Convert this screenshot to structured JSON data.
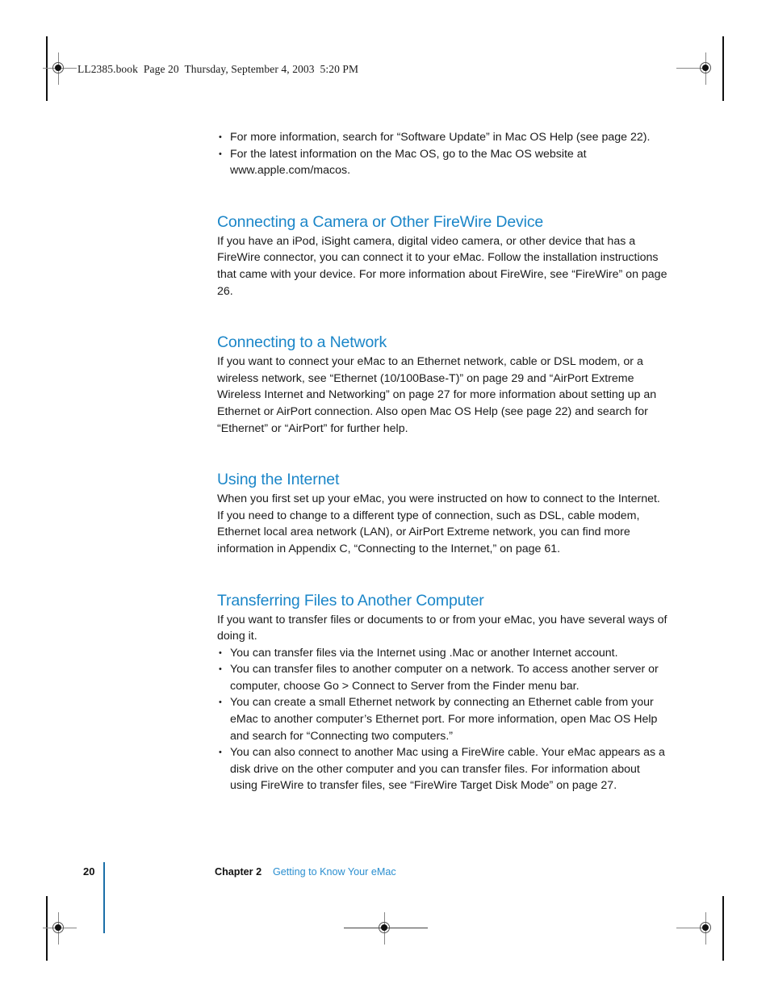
{
  "page": {
    "slug": "LL2385.book  Page 20  Thursday, September 4, 2003  5:20 PM",
    "heading_color": "#1b86c8",
    "body_color": "#1a1a1a",
    "footer_rule_color": "#1b6fa8"
  },
  "intro_bullets": [
    "For more information, search for “Software Update” in Mac OS Help (see page 22).",
    "For the latest information on the Mac OS, go to the Mac OS website at www.apple.com/macos."
  ],
  "sections": [
    {
      "heading": "Connecting a Camera or Other FireWire Device",
      "paragraph": "If you have an iPod, iSight camera, digital video camera, or other device that has a FireWire connector, you can connect it to your eMac. Follow the installation instructions that came with your device. For more information about FireWire, see “FireWire” on page 26.",
      "bullets": []
    },
    {
      "heading": "Connecting to a Network",
      "paragraph": "If you want to connect your eMac to an Ethernet network, cable or DSL modem, or a wireless network, see “Ethernet (10/100Base-T)” on page 29 and “AirPort Extreme Wireless Internet and Networking” on page 27 for more information about setting up an Ethernet or AirPort connection. Also open Mac OS Help (see page 22) and search for “Ethernet” or “AirPort” for further help.",
      "bullets": []
    },
    {
      "heading": "Using the Internet",
      "paragraph": "When you first set up your eMac, you were instructed on how to connect to the Internet. If you need to change to a different type of connection, such as DSL, cable modem, Ethernet local area network (LAN), or AirPort Extreme network, you can find more information in Appendix C, “Connecting to the Internet,” on page 61.",
      "bullets": []
    },
    {
      "heading": "Transferring Files to Another Computer",
      "paragraph": "If you want to transfer files or documents to or from your eMac, you have several ways of doing it.",
      "bullets": [
        "You can transfer files via the Internet using .Mac or another Internet account.",
        "You can transfer files to another computer on a network. To access another server or computer, choose Go > Connect to Server from the Finder menu bar.",
        "You can create a small Ethernet network by connecting an Ethernet cable from your eMac to another computer’s Ethernet port. For more information, open Mac OS Help and search for “Connecting two computers.”",
        "You can also connect to another Mac using a FireWire cable. Your eMac appears as a disk drive on the other computer and you can transfer files. For information about using FireWire to transfer files, see “FireWire Target Disk Mode” on page 27."
      ]
    }
  ],
  "footer": {
    "page_number": "20",
    "chapter_label": "Chapter 2",
    "chapter_title": "Getting to Know Your eMac"
  }
}
